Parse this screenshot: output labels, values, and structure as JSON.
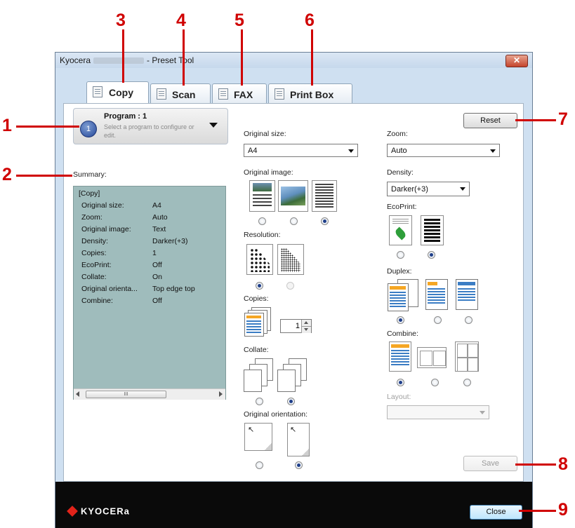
{
  "callouts": [
    "1",
    "2",
    "3",
    "4",
    "5",
    "6",
    "7",
    "8",
    "9"
  ],
  "window": {
    "title_left": "Kyocera",
    "title_right": "- Preset Tool",
    "close_symbol": "✕"
  },
  "tabs": [
    {
      "label": "Copy",
      "active": true
    },
    {
      "label": "Scan",
      "active": false
    },
    {
      "label": "FAX",
      "active": false
    },
    {
      "label": "Print Box",
      "active": false
    }
  ],
  "program": {
    "number": "1",
    "title": "Program : 1",
    "hint_line1": "Select a program to configure or",
    "hint_line2": "edit."
  },
  "summary": {
    "label": "Summary:",
    "header": "[Copy]",
    "rows": [
      {
        "key": "Original size:",
        "value": "A4"
      },
      {
        "key": "Zoom:",
        "value": "Auto"
      },
      {
        "key": "Original image:",
        "value": "Text"
      },
      {
        "key": "Density:",
        "value": "Darker(+3)"
      },
      {
        "key": "Copies:",
        "value": "1"
      },
      {
        "key": "EcoPrint:",
        "value": "Off"
      },
      {
        "key": "Collate:",
        "value": "On"
      },
      {
        "key": "Original orienta...",
        "value": "Top edge top"
      },
      {
        "key": "Combine:",
        "value": "Off"
      }
    ],
    "scroll_thumb_symbol": "III"
  },
  "settings": {
    "original_size": {
      "label": "Original size:",
      "value": "A4"
    },
    "original_image": {
      "label": "Original image:",
      "selected": 2
    },
    "resolution": {
      "label": "Resolution:",
      "selected": 0
    },
    "copies": {
      "label": "Copies:",
      "value": "1"
    },
    "collate": {
      "label": "Collate:",
      "selected": 1
    },
    "original_orientation": {
      "label": "Original orientation:",
      "selected": 1
    },
    "zoom": {
      "label": "Zoom:",
      "value": "Auto"
    },
    "density": {
      "label": "Density:",
      "value": "Darker(+3)"
    },
    "ecoprint": {
      "label": "EcoPrint:",
      "selected": 1
    },
    "duplex": {
      "label": "Duplex:",
      "selected": 0
    },
    "combine": {
      "label": "Combine:",
      "selected": 0
    },
    "layout": {
      "label": "Layout:",
      "value": ""
    }
  },
  "buttons": {
    "reset": "Reset",
    "save": "Save",
    "close": "Close"
  },
  "brand": {
    "logo_text": "KYOCERa"
  },
  "colors": {
    "callout": "#d00000",
    "summary_bg": "#9fbcbc",
    "window_bg": "#cfe0f1",
    "footer_bg": "#0a0a0a"
  }
}
